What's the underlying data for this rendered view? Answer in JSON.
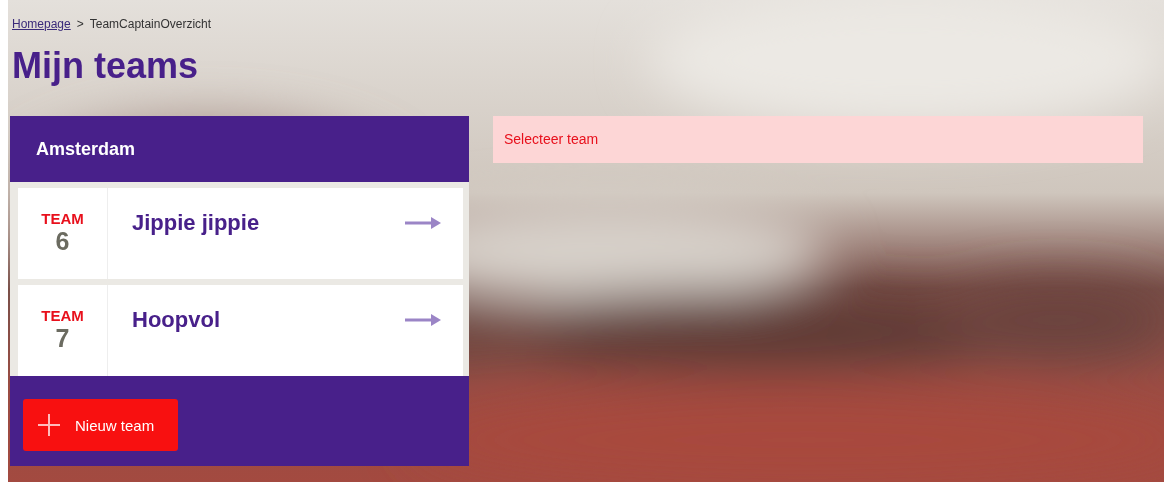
{
  "breadcrumb": {
    "items": [
      {
        "label": "Homepage",
        "kind": "link"
      },
      {
        "label": "TeamCaptainOverzicht",
        "kind": "current"
      }
    ],
    "separator": ">"
  },
  "title": "Mijn teams",
  "group": {
    "name": "Amsterdam",
    "teams": [
      {
        "prefix": "TEAM",
        "number": "6",
        "name": "Jippie jippie"
      },
      {
        "prefix": "TEAM",
        "number": "7",
        "name": "Hoopvol"
      }
    ],
    "button": "Nieuw team"
  },
  "alert": "Selecteer team"
}
